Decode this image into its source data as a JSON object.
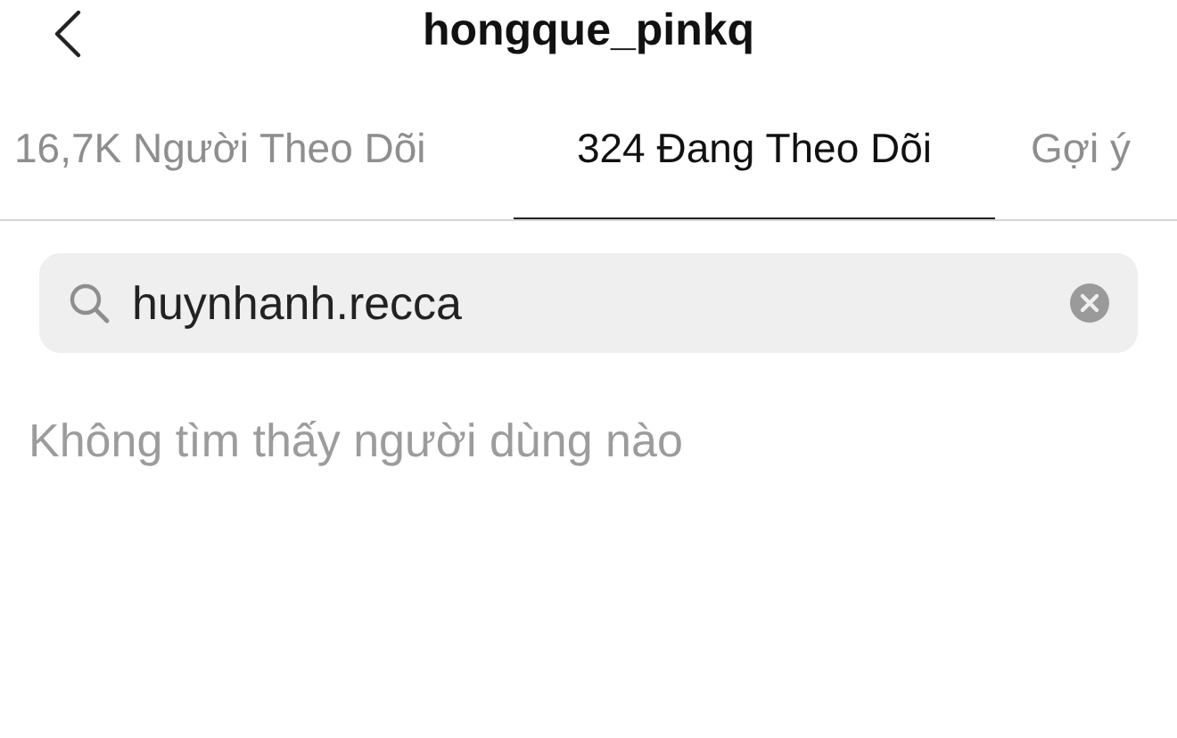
{
  "header": {
    "title": "hongque_pinkq"
  },
  "tabs": [
    {
      "label": "16,7K Người Theo Dõi",
      "selected": false
    },
    {
      "label": "324 Đang Theo Dõi",
      "selected": true
    },
    {
      "label": "Gợi ý",
      "selected": false
    }
  ],
  "search": {
    "value": "huynhanh.recca"
  },
  "empty_message": "Không tìm thấy người dùng nào"
}
